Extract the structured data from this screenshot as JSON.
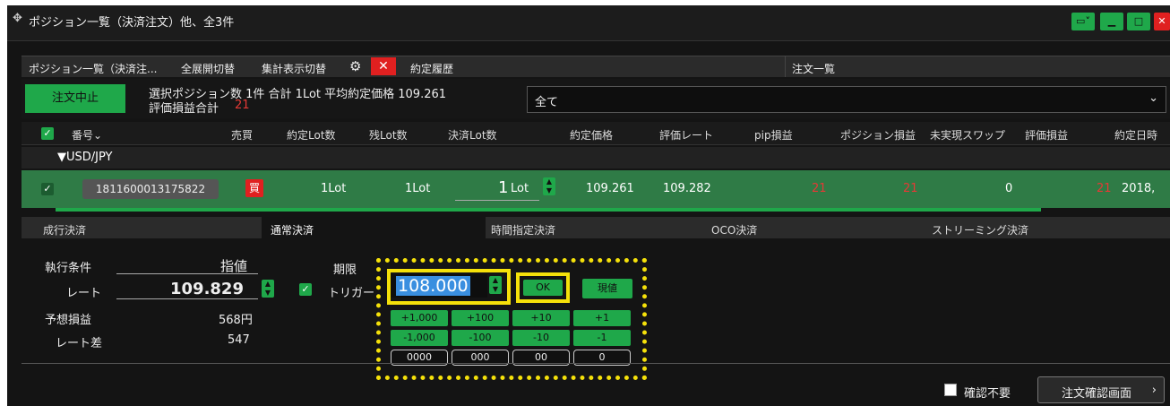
{
  "window": {
    "title": "ポジション一覧（決済注文）他、全3件",
    "btn_layout": "▭˅",
    "btn_min": "▁",
    "btn_max": "□",
    "btn_close": "✕"
  },
  "tabs": {
    "positions": "ポジション一覧（決済注...",
    "expand": "全展開切替",
    "aggregate": "集計表示切替",
    "history": "約定履歴",
    "orders": "注文一覧"
  },
  "summary": {
    "stop_btn": "注文中止",
    "line1": "選択ポジション数 1件  合計 1Lot 平均約定価格 109.261",
    "line2_label": "評価損益合計",
    "line2_value": "21",
    "filter": "全て"
  },
  "table": {
    "headers": [
      "番号",
      "売買",
      "約定Lot数",
      "残Lot数",
      "決済Lot数",
      "約定価格",
      "評価レート",
      "pip損益",
      "ポジション損益",
      "未実現スワップ",
      "評価損益",
      "約定日時"
    ],
    "group": "▼USD/JPY",
    "row": {
      "id": "1811600013175822",
      "side": "買",
      "lot": "1Lot",
      "remain": "1Lot",
      "settle_num": "1",
      "settle_unit": "Lot",
      "price": "109.261",
      "rate": "109.282",
      "pip": "21",
      "pnl": "21",
      "swap": "0",
      "eval": "21",
      "datetime": "2018,"
    }
  },
  "settle_tabs": [
    "成行決済",
    "通常決済",
    "時間指定決済",
    "OCO決済",
    "ストリーミング決済"
  ],
  "form": {
    "exec_label": "執行条件",
    "exec_value": "指値",
    "rate_label": "レート",
    "rate_value": "109.829",
    "expiry_label": "期限",
    "trigger_label": "トリガー",
    "trigger_value": "108.000",
    "ok_btn": "OK",
    "current_btn": "現値",
    "est_label": "予想損益",
    "est_value": "568円",
    "diff_label": "レート差",
    "diff_value": "547"
  },
  "keypad": {
    "row1": [
      "+1,000",
      "+100",
      "+10",
      "+1"
    ],
    "row2": [
      "-1,000",
      "-100",
      "-10",
      "-1"
    ],
    "row3": [
      "0000",
      "000",
      "00",
      "0"
    ]
  },
  "footer": {
    "confirm_skip": "確認不要",
    "confirm_btn": "注文確認画面"
  },
  "colors": {
    "accent": "#1fa84a",
    "highlight": "#f5e10a",
    "loss": "#e53935"
  }
}
